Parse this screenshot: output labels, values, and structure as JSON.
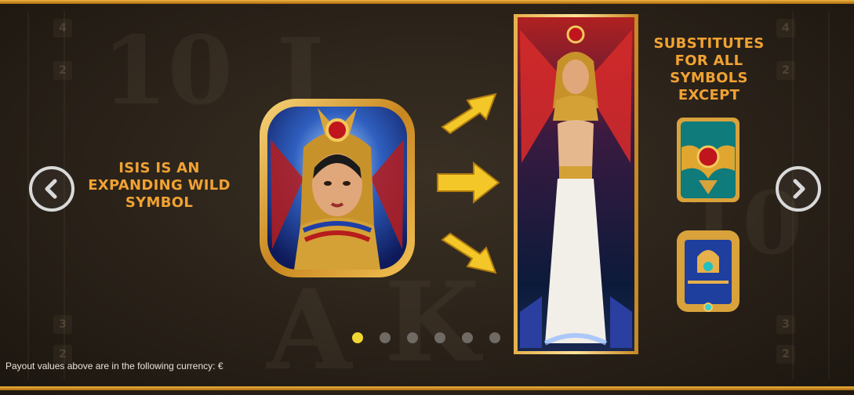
{
  "help_page": {
    "left_caption": "ISIS IS AN EXPANDING WILD SYMBOL",
    "right_caption": "SUBSTITUTES FOR ALL SYMBOLS EXCEPT",
    "currency_note": "Payout values above are in the following currency: €"
  },
  "navigation": {
    "prev_icon": "chevron-left-icon",
    "next_icon": "chevron-right-icon",
    "page_count": 6,
    "active_page": 1
  },
  "background_reels": {
    "glyphs": [
      "10",
      "J",
      "A",
      "K",
      "10"
    ],
    "side_numbers": [
      "4",
      "2",
      "3",
      "2",
      "4",
      "2",
      "3",
      "2"
    ]
  },
  "symbols": {
    "isis": "isis-wild-symbol",
    "expanded": "isis-expanded-wild",
    "exceptions": [
      "scarab-scatter-symbol",
      "book-bonus-symbol"
    ]
  },
  "colors": {
    "caption": "#f1a233",
    "frame_gold": "#e8a63a",
    "dot_active": "#f2d631",
    "dot_inactive": "#6f6a64"
  }
}
